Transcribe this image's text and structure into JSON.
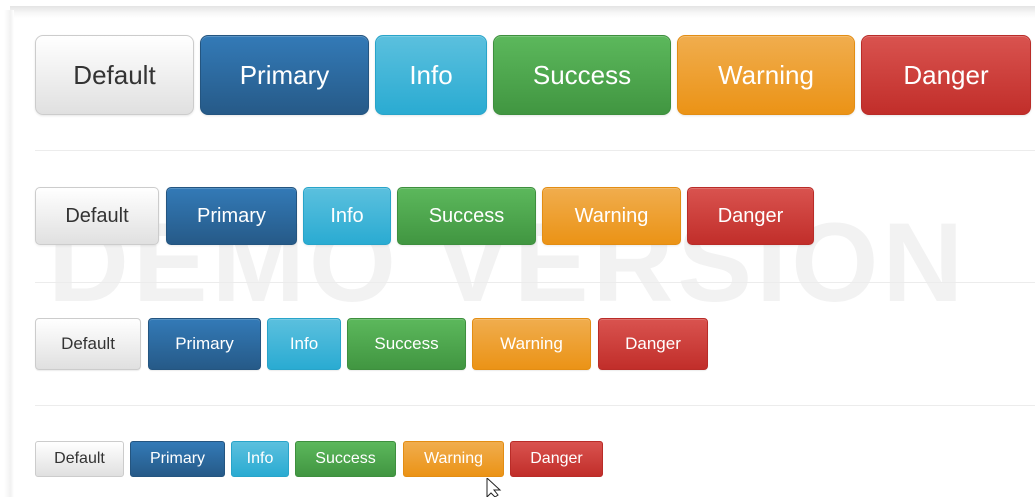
{
  "watermark": "DEMO VERSION",
  "rows": {
    "large": {
      "default": "Default",
      "primary": "Primary",
      "info": "Info",
      "success": "Success",
      "warning": "Warning",
      "danger": "Danger"
    },
    "medium": {
      "default": "Default",
      "primary": "Primary",
      "info": "Info",
      "success": "Success",
      "warning": "Warning",
      "danger": "Danger"
    },
    "small": {
      "default": "Default",
      "primary": "Primary",
      "info": "Info",
      "success": "Success",
      "warning": "Warning",
      "danger": "Danger"
    },
    "xsmall": {
      "default": "Default",
      "primary": "Primary",
      "info": "Info",
      "success": "Success",
      "warning": "Warning",
      "danger": "Danger"
    }
  },
  "colors": {
    "default": "#e0e0e0",
    "primary": "#337ab7",
    "info": "#5bc0de",
    "success": "#5cb85c",
    "warning": "#f0ad4e",
    "danger": "#d9534f"
  },
  "icons": {
    "cursor": "mouse-pointer-icon"
  }
}
